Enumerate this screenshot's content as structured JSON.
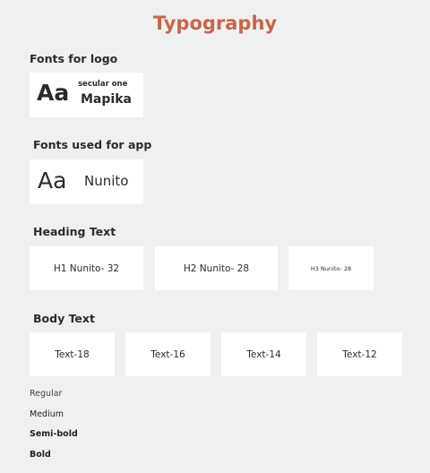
{
  "page": {
    "title": "Typography",
    "accent_color": "#c8664a",
    "background_color": "#f0f0f0"
  },
  "logo_fonts": {
    "heading": "Fonts for logo",
    "sample": "Aa",
    "font_name": "secular one",
    "brand_name": "Mapika"
  },
  "app_fonts": {
    "heading": "Fonts used for app",
    "sample": "Aa",
    "font_name": "Nunito"
  },
  "heading_text": {
    "heading": "Heading Text",
    "items": [
      {
        "label": "H1  Nunito- 32"
      },
      {
        "label": "H2  Nunito- 28"
      },
      {
        "label": "H3   Nunito- 28"
      }
    ]
  },
  "body_text": {
    "heading": "Body Text",
    "items": [
      {
        "label": "Text-18"
      },
      {
        "label": "Text-16"
      },
      {
        "label": "Text-14"
      },
      {
        "label": "Text-12"
      }
    ]
  },
  "weights": [
    {
      "label": "Regular"
    },
    {
      "label": "Medium"
    },
    {
      "label": "Semi-bold"
    },
    {
      "label": "Bold"
    }
  ]
}
